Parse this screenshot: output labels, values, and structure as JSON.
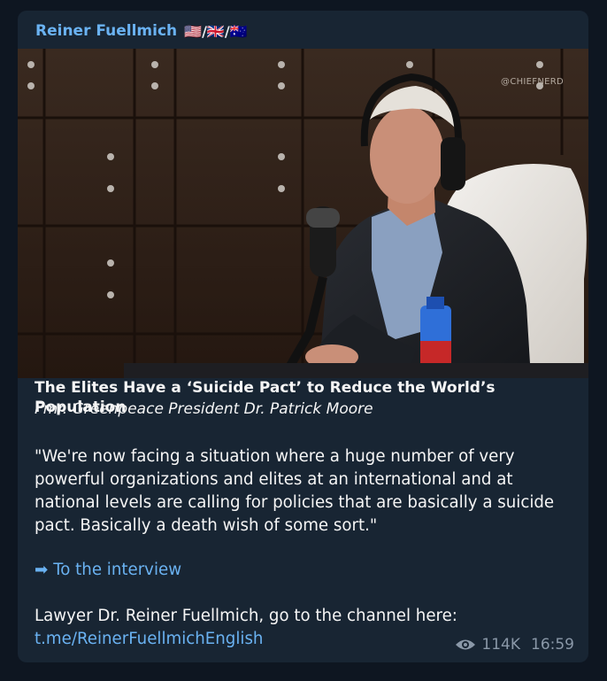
{
  "message": {
    "author": "Reiner Fuellmich",
    "flags": "🇺🇸/🇬🇧/🇦🇺",
    "media": {
      "watermark": "@CHIEFNERD"
    },
    "title": "The Elites Have a ‘Suicide Pact’ to Reduce the World’s Population",
    "subtitle": "Fmr. Greenpeace President Dr. Patrick Moore",
    "quote": "\"We're now facing a situation where a huge number of very powerful organizations and elites at an international and at national levels are calling for policies that are basically a suicide pact. Basically a death wish of some sort.\"",
    "link_arrow": "➡",
    "link_text": "To the interview",
    "lawyer_text": "Lawyer Dr. Reiner Fuellmich, go to the channel here:",
    "channel_link": "t.me/ReinerFuellmichEnglish",
    "views": "114K",
    "time": "16:59"
  }
}
